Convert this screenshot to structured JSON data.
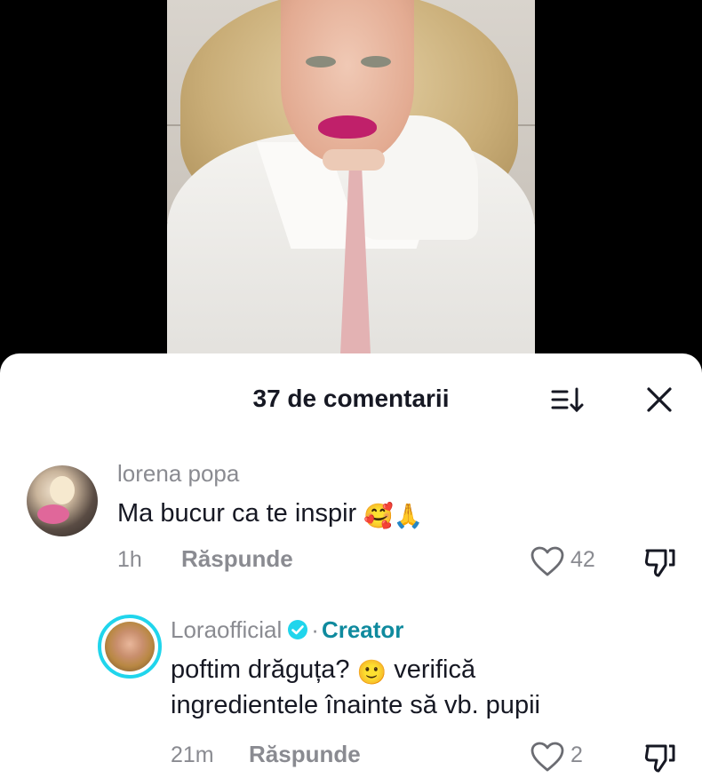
{
  "header": {
    "title": "37 de comentarii"
  },
  "comments": [
    {
      "username": "lorena popa",
      "text": "Ma bucur ca te inspir",
      "emojis": "🥰🙏",
      "time": "1h",
      "reply_label": "Răspunde",
      "likes": "42"
    },
    {
      "username": "Loraofficial",
      "separator": "·",
      "badge": "Creator",
      "text_line1": "poftim drăguța?",
      "emoji": "🙂",
      "text_line1_end": "verifică",
      "text_line2": "ingredientele înainte să vb. pupii",
      "time": "21m",
      "reply_label": "Răspunde",
      "likes": "2"
    }
  ],
  "colors": {
    "background": "#000000",
    "sheet": "#ffffff",
    "text_primary": "#161823",
    "text_secondary": "#8a8b91",
    "creator_accent": "#0f8a9e",
    "avatar_ring": "#20d5ec"
  },
  "icons": [
    "sort-icon",
    "close-icon",
    "verified-icon",
    "heart-icon",
    "dislike-icon"
  ]
}
